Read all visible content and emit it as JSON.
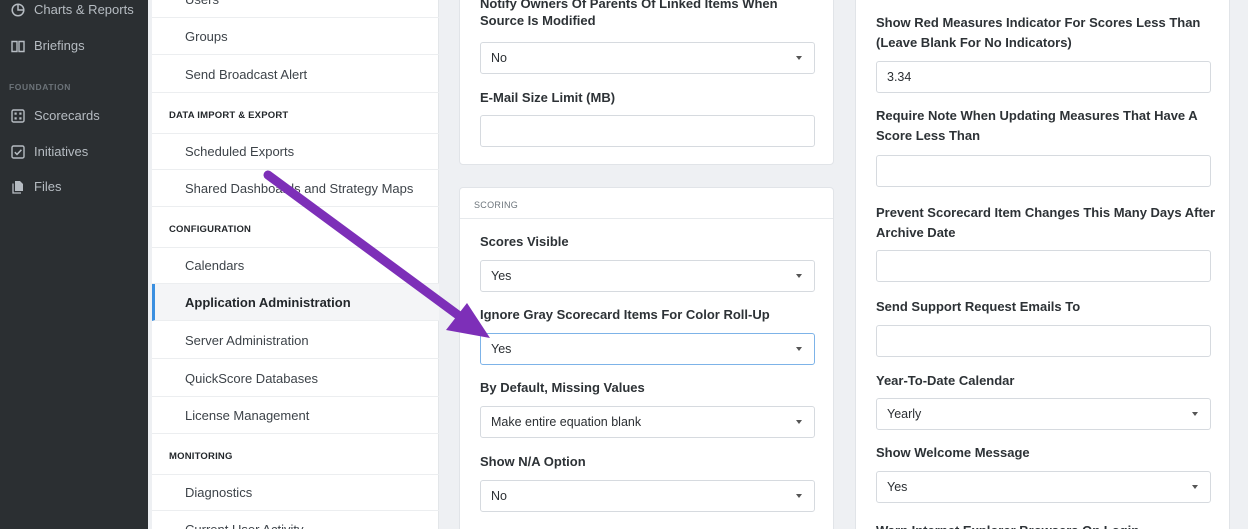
{
  "nav": {
    "items": [
      {
        "label": "Charts & Reports",
        "icon": "pie-chart-icon"
      },
      {
        "label": "Briefings",
        "icon": "book-icon"
      },
      {
        "label": "Scorecards",
        "icon": "scorecard-icon"
      },
      {
        "label": "Initiatives",
        "icon": "checkbox-icon"
      },
      {
        "label": "Files",
        "icon": "files-icon"
      }
    ],
    "section_foundation": "FOUNDATION"
  },
  "subnav": {
    "users_partial": "Users",
    "groups": "Groups",
    "send_broadcast": "Send Broadcast Alert",
    "head_data": "DATA IMPORT & EXPORT",
    "scheduled_exports": "Scheduled Exports",
    "shared_dashboards": "Shared Dashboards and Strategy Maps",
    "head_config": "CONFIGURATION",
    "calendars": "Calendars",
    "app_admin": "Application Administration",
    "server_admin": "Server Administration",
    "quickscore_db": "QuickScore Databases",
    "license_mgmt": "License Management",
    "head_monitoring": "MONITORING",
    "diagnostics": "Diagnostics",
    "current_activity_partial": "Current User Activity"
  },
  "middle_top": {
    "notify_label_line1": "Notify Owners Of Parents Of Linked Items When",
    "notify_label_line2": "Source Is Modified",
    "notify_value": "No",
    "email_size_label": "E-Mail Size Limit (MB)",
    "email_size_value": ""
  },
  "scoring": {
    "title": "SCORING",
    "scores_visible_label": "Scores Visible",
    "scores_visible_value": "Yes",
    "ignore_gray_label": "Ignore Gray Scorecard Items For Color Roll-Up",
    "ignore_gray_value": "Yes",
    "missing_values_label": "By Default, Missing Values",
    "missing_values_value": "Make entire equation blank",
    "show_na_label": "Show N/A Option",
    "show_na_value": "No"
  },
  "right": {
    "red_indicator_label_line1": "Show Red Measures Indicator For Scores Less Than",
    "red_indicator_label_line2": "(Leave Blank For No Indicators)",
    "red_indicator_value": "3.34",
    "require_note_label_line1": "Require Note When Updating Measures That Have A",
    "require_note_label_line2": "Score Less Than",
    "require_note_value": "",
    "prevent_changes_label_line1": "Prevent Scorecard Item Changes This Many Days After",
    "prevent_changes_label_line2": "Archive Date",
    "prevent_changes_value": "",
    "support_email_label": "Send Support Request Emails To",
    "support_email_value": "",
    "ytd_calendar_label": "Year-To-Date Calendar",
    "ytd_calendar_value": "Yearly",
    "welcome_label": "Show Welcome Message",
    "welcome_value": "Yes",
    "warn_ie_label": "Warn Internet Explorer Browsers On Login"
  },
  "colors": {
    "nav_bg": "#2b2f32",
    "accent_active": "#3a8fe0",
    "annotation_arrow": "#7d2fb8"
  }
}
